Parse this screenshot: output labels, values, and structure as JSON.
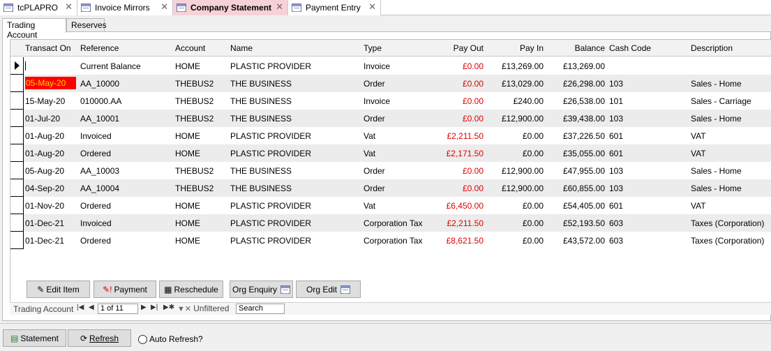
{
  "doc_tabs": [
    {
      "label": "tcPLAPRO",
      "active": false
    },
    {
      "label": "Invoice Mirrors",
      "active": false
    },
    {
      "label": "Company Statement",
      "active": true
    },
    {
      "label": "Payment Entry",
      "active": false
    }
  ],
  "pane_tabs": [
    {
      "label": "Trading Account",
      "active": true
    },
    {
      "label": "Reserves",
      "active": false
    }
  ],
  "columns": {
    "transact_on": "Transact On",
    "reference": "Reference",
    "account": "Account",
    "name": "Name",
    "type": "Type",
    "pay_out": "Pay Out",
    "pay_in": "Pay In",
    "balance": "Balance",
    "cash_code": "Cash Code",
    "description": "Description"
  },
  "rows": [
    {
      "transact_on": "",
      "reference": "Current Balance",
      "account": "HOME",
      "name": "PLASTIC PROVIDER",
      "type": "Invoice",
      "pay_out": "£0.00",
      "pay_in": "£13,269.00",
      "balance": "£13,269.00",
      "cash_code": "",
      "description": ""
    },
    {
      "transact_on": "05-May-20",
      "reference": "AA_10000",
      "account": "THEBUS2",
      "name": "THE BUSINESS",
      "type": "Order",
      "pay_out": "£0.00",
      "pay_in": "£13,029.00",
      "balance": "£26,298.00",
      "cash_code": "103",
      "description": "Sales - Home"
    },
    {
      "transact_on": "15-May-20",
      "reference": "010000.AA",
      "account": "THEBUS2",
      "name": "THE BUSINESS",
      "type": "Invoice",
      "pay_out": "£0.00",
      "pay_in": "£240.00",
      "balance": "£26,538.00",
      "cash_code": "101",
      "description": "Sales - Carriage"
    },
    {
      "transact_on": "01-Jul-20",
      "reference": "AA_10001",
      "account": "THEBUS2",
      "name": "THE BUSINESS",
      "type": "Order",
      "pay_out": "£0.00",
      "pay_in": "£12,900.00",
      "balance": "£39,438.00",
      "cash_code": "103",
      "description": "Sales - Home"
    },
    {
      "transact_on": "01-Aug-20",
      "reference": "Invoiced",
      "account": "HOME",
      "name": "PLASTIC PROVIDER",
      "type": "Vat",
      "pay_out": "£2,211.50",
      "pay_in": "£0.00",
      "balance": "£37,226.50",
      "cash_code": "601",
      "description": "VAT"
    },
    {
      "transact_on": "01-Aug-20",
      "reference": "Ordered",
      "account": "HOME",
      "name": "PLASTIC PROVIDER",
      "type": "Vat",
      "pay_out": "£2,171.50",
      "pay_in": "£0.00",
      "balance": "£35,055.00",
      "cash_code": "601",
      "description": "VAT"
    },
    {
      "transact_on": "05-Aug-20",
      "reference": "AA_10003",
      "account": "THEBUS2",
      "name": "THE BUSINESS",
      "type": "Order",
      "pay_out": "£0.00",
      "pay_in": "£12,900.00",
      "balance": "£47,955.00",
      "cash_code": "103",
      "description": "Sales - Home"
    },
    {
      "transact_on": "04-Sep-20",
      "reference": "AA_10004",
      "account": "THEBUS2",
      "name": "THE BUSINESS",
      "type": "Order",
      "pay_out": "£0.00",
      "pay_in": "£12,900.00",
      "balance": "£60,855.00",
      "cash_code": "103",
      "description": "Sales - Home"
    },
    {
      "transact_on": "01-Nov-20",
      "reference": "Ordered",
      "account": "HOME",
      "name": "PLASTIC PROVIDER",
      "type": "Vat",
      "pay_out": "£6,450.00",
      "pay_in": "£0.00",
      "balance": "£54,405.00",
      "cash_code": "601",
      "description": "VAT"
    },
    {
      "transact_on": "01-Dec-21",
      "reference": "Invoiced",
      "account": "HOME",
      "name": "PLASTIC PROVIDER",
      "type": "Corporation Tax",
      "pay_out": "£2,211.50",
      "pay_in": "£0.00",
      "balance": "£52,193.50",
      "cash_code": "603",
      "description": "Taxes (Corporation)"
    },
    {
      "transact_on": "01-Dec-21",
      "reference": "Ordered",
      "account": "HOME",
      "name": "PLASTIC PROVIDER",
      "type": "Corporation Tax",
      "pay_out": "£8,621.50",
      "pay_in": "£0.00",
      "balance": "£43,572.00",
      "cash_code": "603",
      "description": "Taxes (Corporation)"
    }
  ],
  "action_buttons": {
    "edit_item": "Edit Item",
    "payment": "Payment",
    "reschedule": "Reschedule",
    "org_enquiry": "Org Enquiry",
    "org_edit": "Org Edit"
  },
  "nav": {
    "label": "Trading Account",
    "record": "1 of 11",
    "filter": "Unfiltered",
    "search": "Search"
  },
  "bottom": {
    "statement": "Statement",
    "refresh": "Refresh",
    "auto_refresh": "Auto Refresh?"
  },
  "colors": {
    "active_tab": "#f6d2d8",
    "negative": "#e00000",
    "highlight_bg": "#ff0000",
    "highlight_fg": "#ffd400"
  }
}
